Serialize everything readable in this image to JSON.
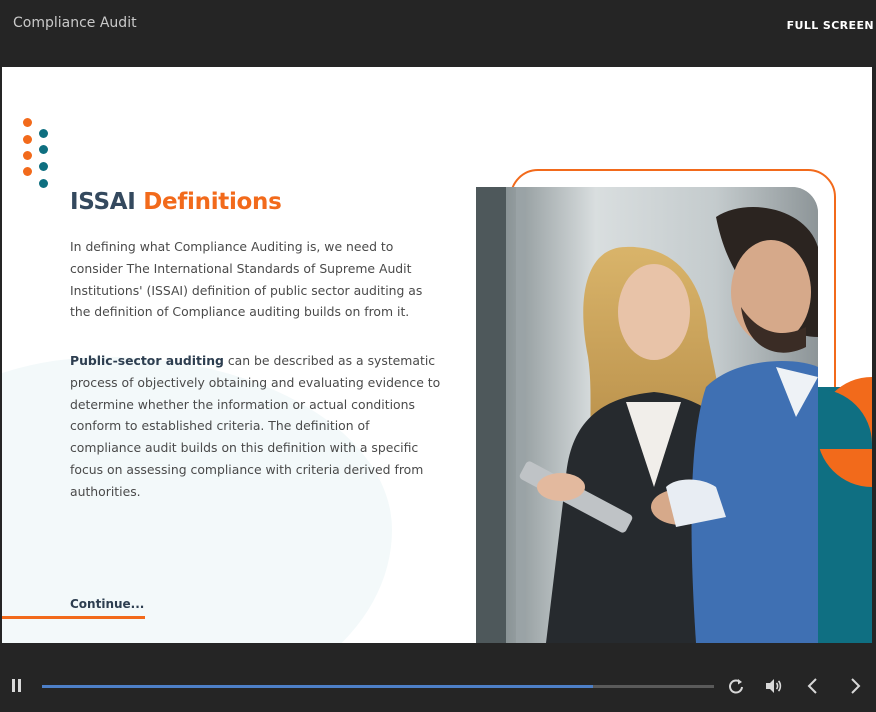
{
  "topbar": {
    "course_title": "Compliance Audit",
    "fullscreen_label": "FULL SCREEN"
  },
  "slide": {
    "heading_part1": "ISSAI",
    "heading_part2": "Definitions",
    "paragraph1": "In defining what Compliance Auditing is, we need to consider The International Standards of Supreme Audit Institutions' (ISSAI) definition of public sector auditing as the definition of Compliance auditing builds on from it.",
    "paragraph2_bold": "Public-sector auditing",
    "paragraph2_rest": " can be described as a systematic process of objectively obtaining and evaluating evidence to determine whether the information or actual conditions conform to established criteria. The definition of compliance audit builds on this definition with a specific focus on assessing compliance with criteria derived from authorities.",
    "continue_label": "Continue...",
    "photo_alt": "two business people looking at a tablet"
  },
  "player": {
    "progress_fraction": 0.82,
    "icons": [
      "pause-icon",
      "replay-icon",
      "volume-icon",
      "chevron-left-icon",
      "chevron-right-icon"
    ]
  },
  "colors": {
    "accent_orange": "#f26a1b",
    "accent_teal": "#0e6f80",
    "heading_dark": "#34495e",
    "progress_blue": "#4d7fc7",
    "chrome_bg": "#252525"
  }
}
